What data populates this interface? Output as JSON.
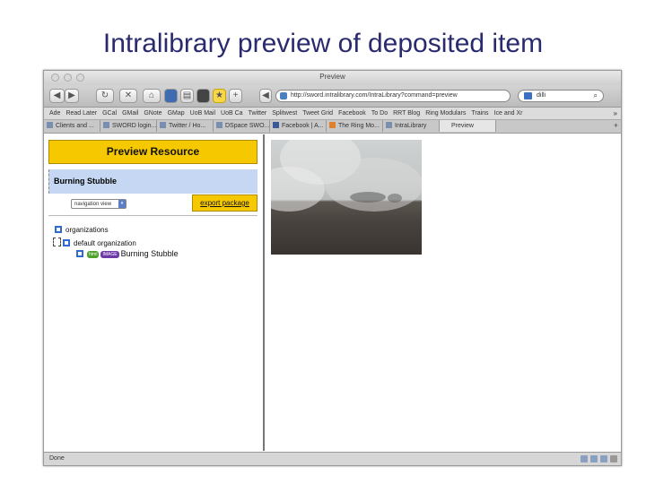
{
  "slide": {
    "title": "Intralibrary preview of deposited item"
  },
  "window": {
    "title": "Preview"
  },
  "toolbar": {
    "url": "http://sword.intralibrary.com/IntraLibrary?command=preview",
    "search_value": "dilli"
  },
  "bookmarks": {
    "items": [
      "Ade",
      "Read Later",
      "GCal",
      "GMail",
      "GNote",
      "GMap",
      "UoB Mail",
      "UoB Ca",
      "Twitter",
      "Splitwest",
      "Tweet Grid",
      "Facebook",
      "To Do",
      "RRT Blog",
      "Ring Modulars",
      "Trains",
      "Ice and Xr"
    ],
    "more": "»"
  },
  "tabs": {
    "items": [
      {
        "label": "Clients and ..."
      },
      {
        "label": "SWORD login..."
      },
      {
        "label": "Twitter / Ho..."
      },
      {
        "label": "DSpace SWO..."
      },
      {
        "label": "Facebook | A..."
      },
      {
        "label": "The Ring Mo..."
      },
      {
        "label": "IntraLibrary"
      },
      {
        "label": "Preview"
      }
    ],
    "add": "+"
  },
  "left": {
    "header": "Preview Resource",
    "resource_title": "Burning Stubble",
    "nav_select": "navigation view",
    "export_button": "export package",
    "tree": {
      "root": "organizations",
      "child": "default organization",
      "leaf": "Burning Stubble",
      "badge_green": "html",
      "badge_purple": "IMAGE"
    }
  },
  "status": {
    "text": "Done"
  },
  "colors": {
    "title": "#2a2a6e",
    "header_yellow": "#f6c800",
    "band_blue": "#c5d7f2",
    "checkbox_blue": "#2f6ad0"
  }
}
